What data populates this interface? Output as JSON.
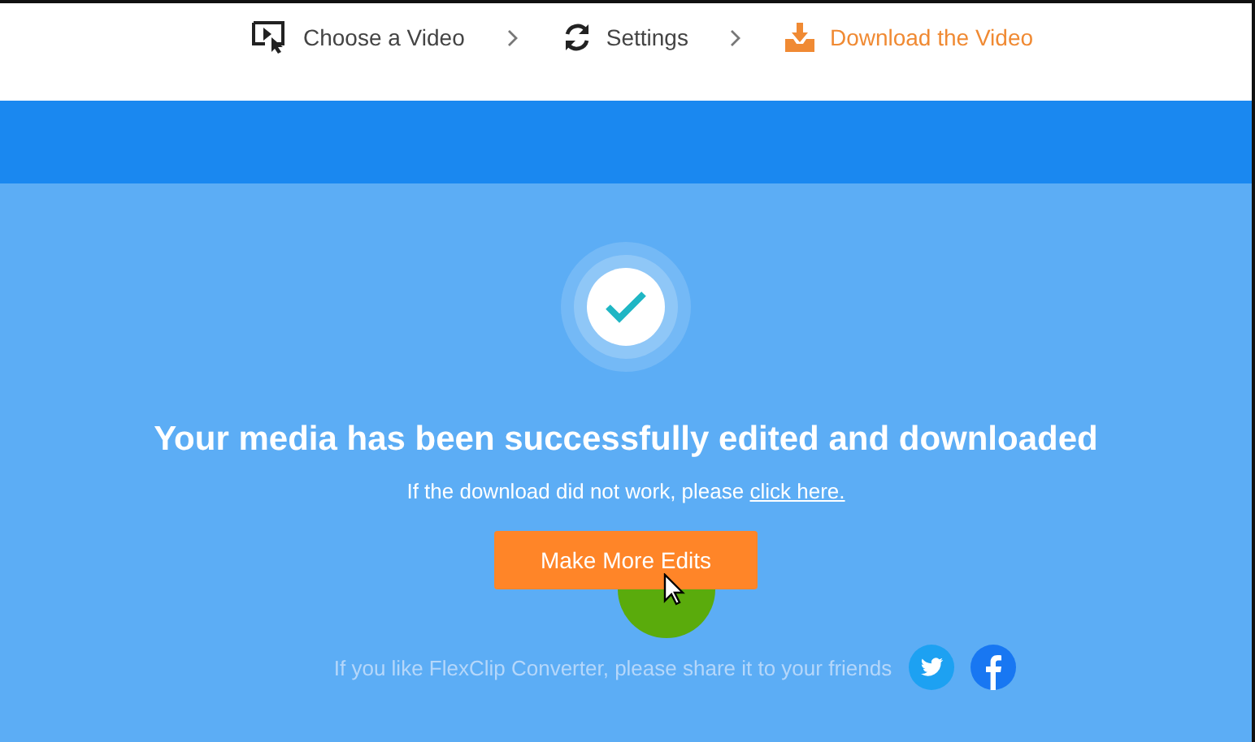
{
  "steps": [
    {
      "label": "Choose a Video",
      "kind": "video",
      "selected": false
    },
    {
      "label": "Settings",
      "kind": "sync",
      "selected": false
    },
    {
      "label": "Download the Video",
      "kind": "download",
      "selected": true
    }
  ],
  "result": {
    "heading": "Your media has been successfully edited and downloaded",
    "note": "If the download did not work, please",
    "link": "click here.",
    "button": "Make More Edits"
  },
  "share": {
    "text": "If you like FlexClip Converter, please share it to your friends",
    "networks": [
      {
        "kind": "twitter"
      },
      {
        "kind": "facebook"
      }
    ]
  }
}
